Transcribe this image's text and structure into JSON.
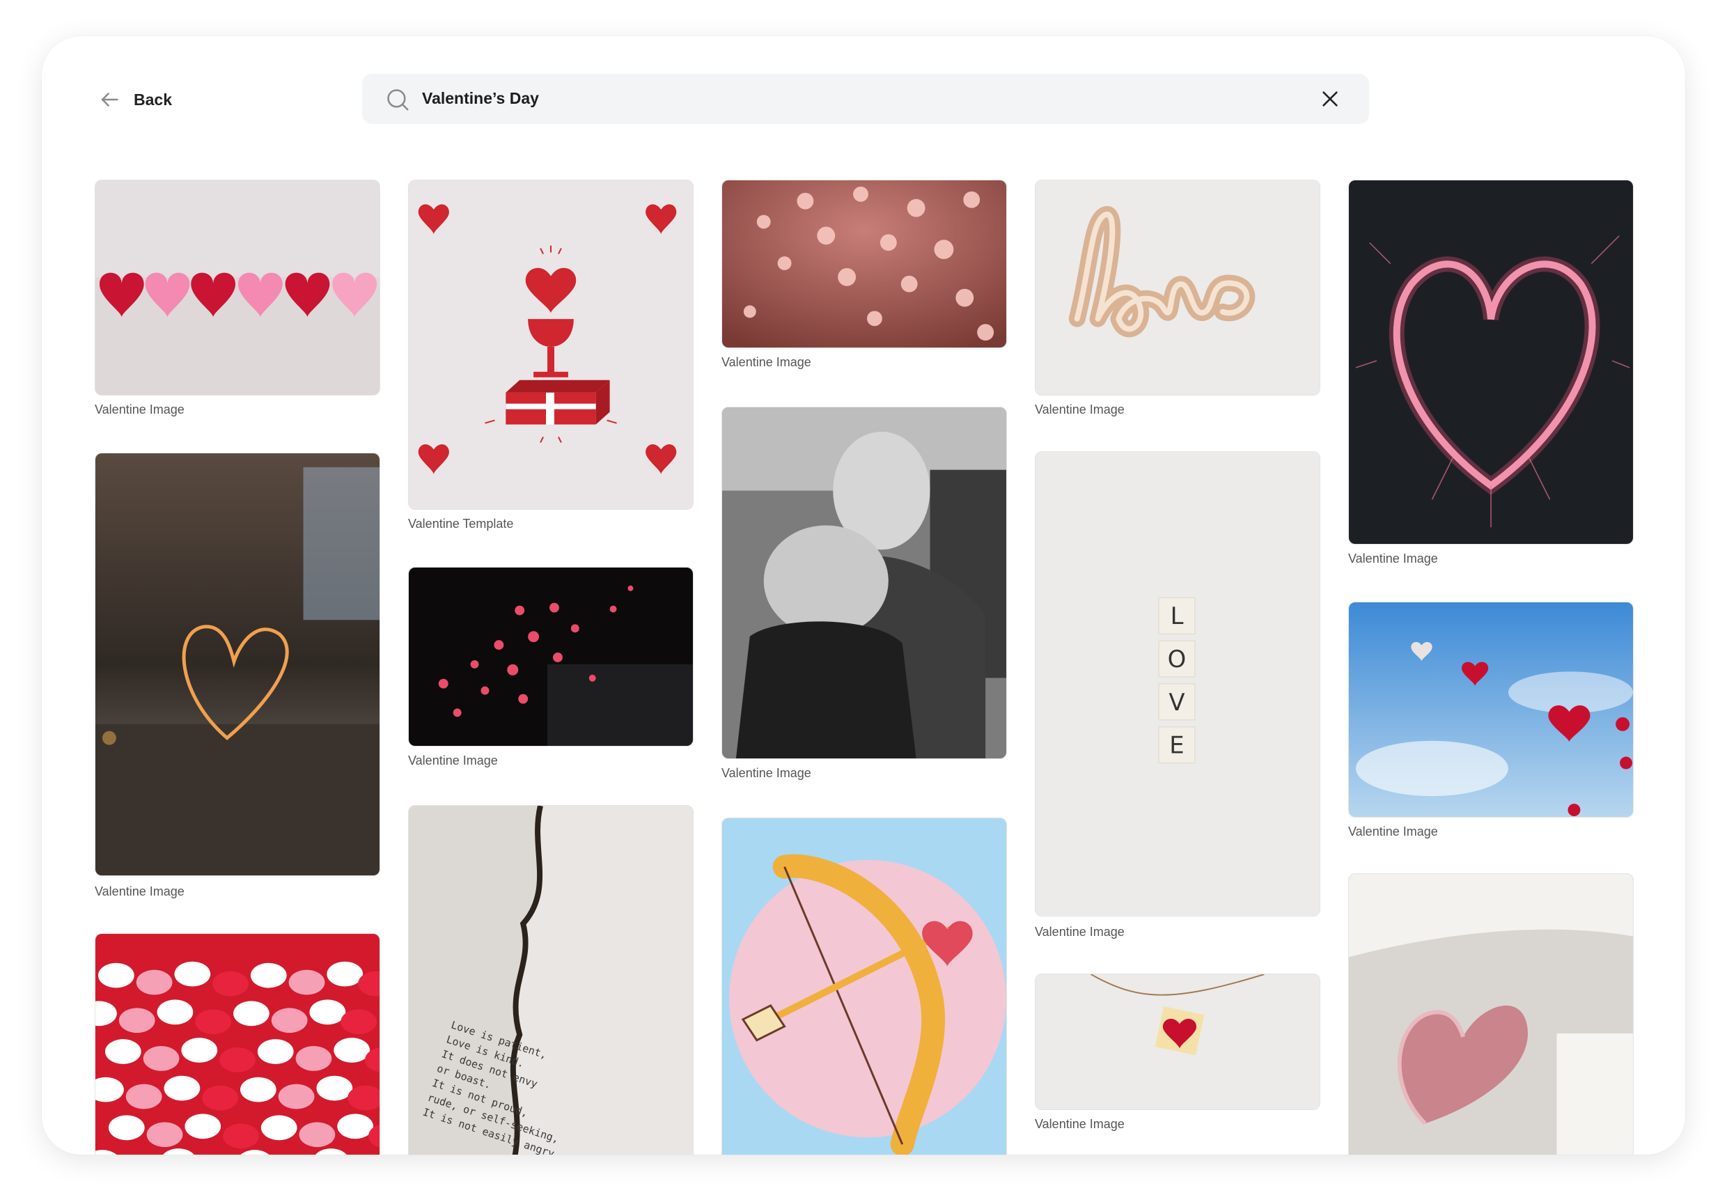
{
  "header": {
    "back_label": "Back",
    "search_value": "Valentine’s Day"
  },
  "tiles": [
    {
      "caption": "Valentine Image",
      "icon": "paper-hearts-row-image"
    },
    {
      "caption": "Valentine Image",
      "icon": "sparkler-heart-image"
    },
    {
      "caption": "Valentine Image",
      "icon": "candy-hearts-image"
    },
    {
      "caption": "Valentine Template",
      "icon": "heart-gift-card-template"
    },
    {
      "caption": "Valentine Image",
      "icon": "heart-bokeh-dark-image"
    },
    {
      "caption": "",
      "icon": "burnt-love-letter-image"
    },
    {
      "caption": "Valentine Image",
      "icon": "pink-heart-bokeh-image"
    },
    {
      "caption": "Valentine Image",
      "icon": "elderly-couple-kiss-image"
    },
    {
      "caption": "",
      "icon": "cupid-bow-illustration"
    },
    {
      "caption": "Valentine Image",
      "icon": "love-balloon-image"
    },
    {
      "caption": "Valentine Image",
      "icon": "scrabble-love-tiles-image"
    },
    {
      "caption": "Valentine Image",
      "icon": "hanging-heart-note-image"
    },
    {
      "caption": "Valentine Image",
      "icon": "light-heart-sparkles-image"
    },
    {
      "caption": "Valentine Image",
      "icon": "heart-balloons-sky-image"
    },
    {
      "caption": "",
      "icon": "pink-heart-balloon-image"
    }
  ],
  "letter_text": "Love is patient, Love is kind. It does not envy or boast. It is not proud, rude, or self-seeking, It is not easily angry and keeps no record of past mistakes.",
  "scrabble_letters": [
    "L",
    "O",
    "V",
    "E"
  ],
  "colors": {
    "accent": "#c8102e",
    "search_bg": "#f3f4f6",
    "caption": "#555555"
  }
}
